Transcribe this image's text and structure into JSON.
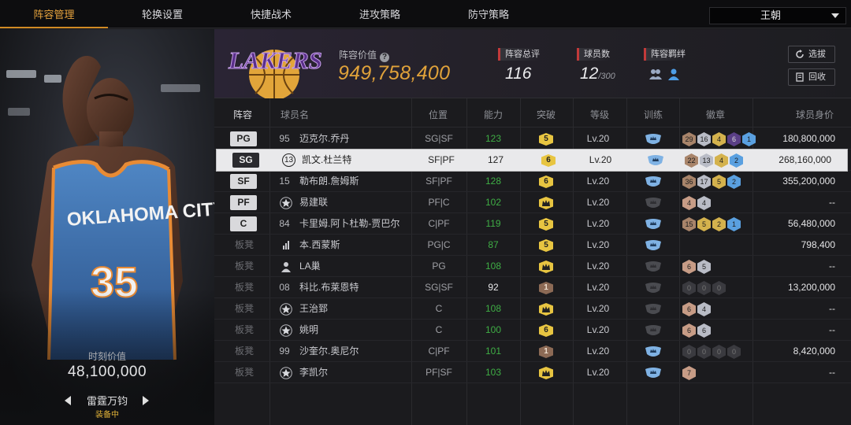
{
  "nav": {
    "tabs": [
      "阵容管理",
      "轮换设置",
      "快捷战术",
      "进攻策略",
      "防守策略"
    ],
    "active_tab": "阵容管理",
    "team_select": "王朝"
  },
  "player_card": {
    "jersey_team": "OKLAHOMA CITY",
    "jersey_number": "35",
    "moment_label": "时刻价值",
    "moment_value": "48,100,000",
    "skill_name": "雷霆万钧",
    "equip_status": "装备中"
  },
  "header": {
    "team_logo_text": "LAKERS",
    "lineup_value_label": "阵容价值",
    "lineup_value": "949,758,400",
    "total_rating_label": "阵容总评",
    "total_rating": "116",
    "player_count_label": "球员数",
    "player_count": "12",
    "player_count_max": "/300",
    "bond_label": "阵容羁绊",
    "auto_pick_button": "选拔",
    "recycle_button": "回收"
  },
  "table": {
    "headers": {
      "lineup": "阵容",
      "name": "球员名",
      "position": "位置",
      "ability": "能力",
      "breakthrough": "突破",
      "level": "等级",
      "training": "训练",
      "badges": "徽章",
      "value": "球员身价"
    },
    "rows": [
      {
        "slot": "PG",
        "starter": true,
        "number": "95",
        "number_style": "plain",
        "name": "迈克尔.乔丹",
        "position": "SG|SF",
        "ability": "123",
        "ability_color": "green",
        "breakthrough": "5",
        "breakthrough_style": "yellow",
        "level": "Lv.20",
        "badges": [
          "29",
          "16",
          "4",
          "6",
          "1"
        ],
        "value": "180,800,000"
      },
      {
        "slot": "SG",
        "starter": true,
        "selected": true,
        "number": "13",
        "number_style": "circle",
        "name": "凯文.杜兰特",
        "position": "SF|PF",
        "ability": "127",
        "ability_color": "white",
        "breakthrough": "6",
        "breakthrough_style": "yellow",
        "level": "Lv.20",
        "badges": [
          "22",
          "13",
          "4",
          "2"
        ],
        "value": "268,160,000"
      },
      {
        "slot": "SF",
        "starter": true,
        "number": "15",
        "number_style": "plain",
        "name": "勒布朗.詹姆斯",
        "position": "SF|PF",
        "ability": "128",
        "ability_color": "green",
        "breakthrough": "6",
        "breakthrough_style": "yellow",
        "level": "Lv.20",
        "badges": [
          "36",
          "17",
          "5",
          "2"
        ],
        "value": "355,200,000"
      },
      {
        "slot": "PF",
        "starter": true,
        "number": "",
        "number_style": "star",
        "name": "易建联",
        "position": "PF|C",
        "ability": "102",
        "ability_color": "green",
        "breakthrough": "crown",
        "breakthrough_style": "yellow",
        "level": "Lv.20",
        "badges": [
          "4",
          "4"
        ],
        "value": "--"
      },
      {
        "slot": "C",
        "starter": true,
        "number": "84",
        "number_style": "plain",
        "name": "卡里姆.阿卜杜勒-贾巴尔",
        "position": "C|PF",
        "ability": "119",
        "ability_color": "green",
        "breakthrough": "5",
        "breakthrough_style": "yellow",
        "level": "Lv.20",
        "badges": [
          "15",
          "5",
          "2",
          "1"
        ],
        "value": "56,480,000"
      },
      {
        "slot": "板凳",
        "starter": false,
        "number": "",
        "number_style": "bars",
        "name": "本.西蒙斯",
        "position": "PG|C",
        "ability": "87",
        "ability_color": "green",
        "breakthrough": "5",
        "breakthrough_style": "yellow",
        "level": "Lv.20",
        "badges": [],
        "value": "798,400"
      },
      {
        "slot": "板凳",
        "starter": false,
        "number": "",
        "number_style": "person",
        "name": "LA巢",
        "position": "PG",
        "ability": "108",
        "ability_color": "green",
        "breakthrough": "crown",
        "breakthrough_style": "yellow",
        "level": "Lv.20",
        "badges": [
          "6",
          "5"
        ],
        "value": "--"
      },
      {
        "slot": "板凳",
        "starter": false,
        "number": "08",
        "number_style": "plain",
        "name": "科比.布莱恩特",
        "position": "SG|SF",
        "ability": "92",
        "ability_color": "white",
        "breakthrough": "1",
        "breakthrough_style": "bronze",
        "level": "Lv.20",
        "badges": [
          "0",
          "0",
          "0"
        ],
        "value": "13,200,000"
      },
      {
        "slot": "板凳",
        "starter": false,
        "number": "",
        "number_style": "star",
        "name": "王治郅",
        "position": "C",
        "ability": "108",
        "ability_color": "green",
        "breakthrough": "crown",
        "breakthrough_style": "yellow",
        "level": "Lv.20",
        "badges": [
          "6",
          "4"
        ],
        "value": "--"
      },
      {
        "slot": "板凳",
        "starter": false,
        "number": "",
        "number_style": "star",
        "name": "姚明",
        "position": "C",
        "ability": "100",
        "ability_color": "green",
        "breakthrough": "6",
        "breakthrough_style": "yellow",
        "level": "Lv.20",
        "badges": [
          "6",
          "6"
        ],
        "value": "--"
      },
      {
        "slot": "板凳",
        "starter": false,
        "number": "99",
        "number_style": "plain",
        "name": "沙奎尔.奥尼尔",
        "position": "C|PF",
        "ability": "101",
        "ability_color": "green",
        "breakthrough": "1",
        "breakthrough_style": "bronze",
        "level": "Lv.20",
        "badges": [
          "0",
          "0",
          "0",
          "0"
        ],
        "value": "8,420,000"
      },
      {
        "slot": "板凳",
        "starter": false,
        "number": "",
        "number_style": "star",
        "name": "李凯尔",
        "position": "PF|SF",
        "ability": "103",
        "ability_color": "green",
        "breakthrough": "crown",
        "breakthrough_style": "yellow",
        "level": "Lv.20",
        "badges": [
          "7"
        ],
        "value": "--"
      }
    ]
  },
  "colors": {
    "accent": "#d08a24",
    "value_gold": "#e0a23a",
    "ability_green": "#3fae45",
    "stat_marker": "#c23a3a"
  }
}
